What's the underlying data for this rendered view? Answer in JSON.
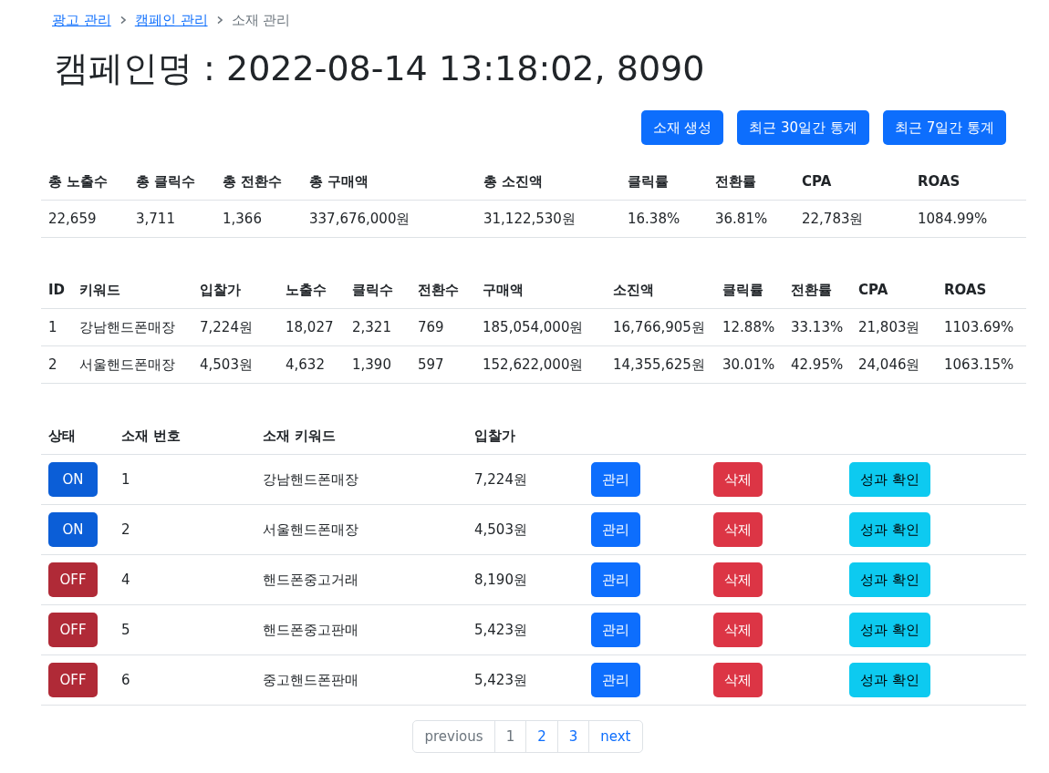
{
  "breadcrumb": [
    {
      "label": "광고 관리",
      "link": true
    },
    {
      "label": "캠페인 관리",
      "link": true
    },
    {
      "label": "소재 관리",
      "link": false
    }
  ],
  "title": "캠페인명 : 2022-08-14 13:18:02, 8090",
  "actions": [
    "소재 생성",
    "최근 30일간 통계",
    "최근 7일간 통계"
  ],
  "summary": {
    "columns": [
      "총 노출수",
      "총 클릭수",
      "총 전환수",
      "총 구매액",
      "총 소진액",
      "클릭률",
      "전환률",
      "CPA",
      "ROAS"
    ],
    "rows": [
      [
        "22,659",
        "3,711",
        "1,366",
        "337,676,000원",
        "31,122,530원",
        "16.38%",
        "36.81%",
        "22,783원",
        "1084.99%"
      ]
    ]
  },
  "keywords": {
    "columns": [
      "ID",
      "키워드",
      "입찰가",
      "노출수",
      "클릭수",
      "전환수",
      "구매액",
      "소진액",
      "클릭률",
      "전환률",
      "CPA",
      "ROAS"
    ],
    "rows": [
      [
        "1",
        "강남핸드폰매장",
        "7,224원",
        "18,027",
        "2,321",
        "769",
        "185,054,000원",
        "16,766,905원",
        "12.88%",
        "33.13%",
        "21,803원",
        "1103.69%"
      ],
      [
        "2",
        "서울핸드폰매장",
        "4,503원",
        "4,632",
        "1,390",
        "597",
        "152,622,000원",
        "14,355,625원",
        "30.01%",
        "42.95%",
        "24,046원",
        "1063.15%"
      ]
    ]
  },
  "materials": {
    "columns": [
      "상태",
      "소재 번호",
      "소재 키워드",
      "입찰가"
    ],
    "rows": [
      {
        "status": "ON",
        "on": true,
        "number": "1",
        "keyword": "강남핸드폰매장",
        "bid": "7,224원",
        "actions": [
          {
            "kind": "manage",
            "label": "관리"
          },
          {
            "kind": "delete",
            "label": "삭제"
          },
          {
            "kind": "stats",
            "label": "성과 확인"
          }
        ]
      },
      {
        "status": "ON",
        "on": true,
        "number": "2",
        "keyword": "서울핸드폰매장",
        "bid": "4,503원",
        "actions": [
          {
            "kind": "manage",
            "label": "관리"
          },
          {
            "kind": "delete",
            "label": "삭제"
          },
          {
            "kind": "stats",
            "label": "성과 확인"
          }
        ]
      },
      {
        "status": "OFF",
        "on": false,
        "number": "4",
        "keyword": "핸드폰중고거래",
        "bid": "8,190원",
        "actions": [
          {
            "kind": "manage",
            "label": "관리"
          },
          {
            "kind": "delete",
            "label": "삭제"
          },
          {
            "kind": "stats",
            "label": "성과 확인"
          }
        ]
      },
      {
        "status": "OFF",
        "on": false,
        "number": "5",
        "keyword": "핸드폰중고판매",
        "bid": "5,423원",
        "actions": [
          {
            "kind": "manage",
            "label": "관리"
          },
          {
            "kind": "delete",
            "label": "삭제"
          },
          {
            "kind": "stats",
            "label": "성과 확인"
          }
        ]
      },
      {
        "status": "OFF",
        "on": false,
        "number": "6",
        "keyword": "중고핸드폰판매",
        "bid": "5,423원",
        "actions": [
          {
            "kind": "manage",
            "label": "관리"
          },
          {
            "kind": "delete",
            "label": "삭제"
          },
          {
            "kind": "stats",
            "label": "성과 확인"
          }
        ]
      }
    ]
  },
  "pagination": {
    "previous": {
      "label": "previous",
      "disabled": true
    },
    "pages": [
      {
        "label": "1",
        "selected": true
      },
      {
        "label": "2",
        "selected": false
      },
      {
        "label": "3",
        "selected": false
      }
    ],
    "next": {
      "label": "next",
      "disabled": false
    }
  }
}
